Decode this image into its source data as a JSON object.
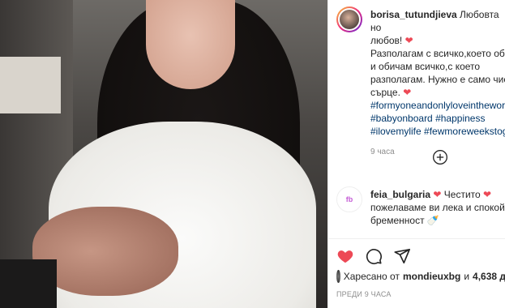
{
  "post": {
    "username": "borisa_tutundjieva",
    "caption_line1": "Любовта но",
    "caption_line2": "любов!",
    "caption_line3": "Разполагам с всичко,което оби",
    "caption_line4": "и обичам всичко,с което",
    "caption_line5": "разполагам. Нужно е само чис",
    "caption_line6": "сърце.",
    "hashtags": [
      "#formyoneandonlyloveinthewor",
      "#babyonboard",
      "#happiness",
      "#ilovemylife",
      "#fewmoreweekstog"
    ],
    "time_ago": "9 часа"
  },
  "comment": {
    "username": "feia_bulgaria",
    "text_line1": "Честито",
    "text_line2": "пожелаваме ви лека и спокойн",
    "text_line3": "бременност"
  },
  "likes": {
    "prefix": "Харесано от",
    "by_user": "mondieuxbg",
    "and": "и",
    "count": "4,638 д"
  },
  "footer": {
    "time_label": "ПРЕДИ 9 ЧАСА"
  },
  "icons": {
    "like": "heart-icon",
    "comment": "comment-icon",
    "share": "share-icon",
    "load_more": "plus-circle-icon"
  },
  "colors": {
    "heart": "#ed4956",
    "hashtag": "#00376b",
    "muted": "#8e8e8e"
  }
}
